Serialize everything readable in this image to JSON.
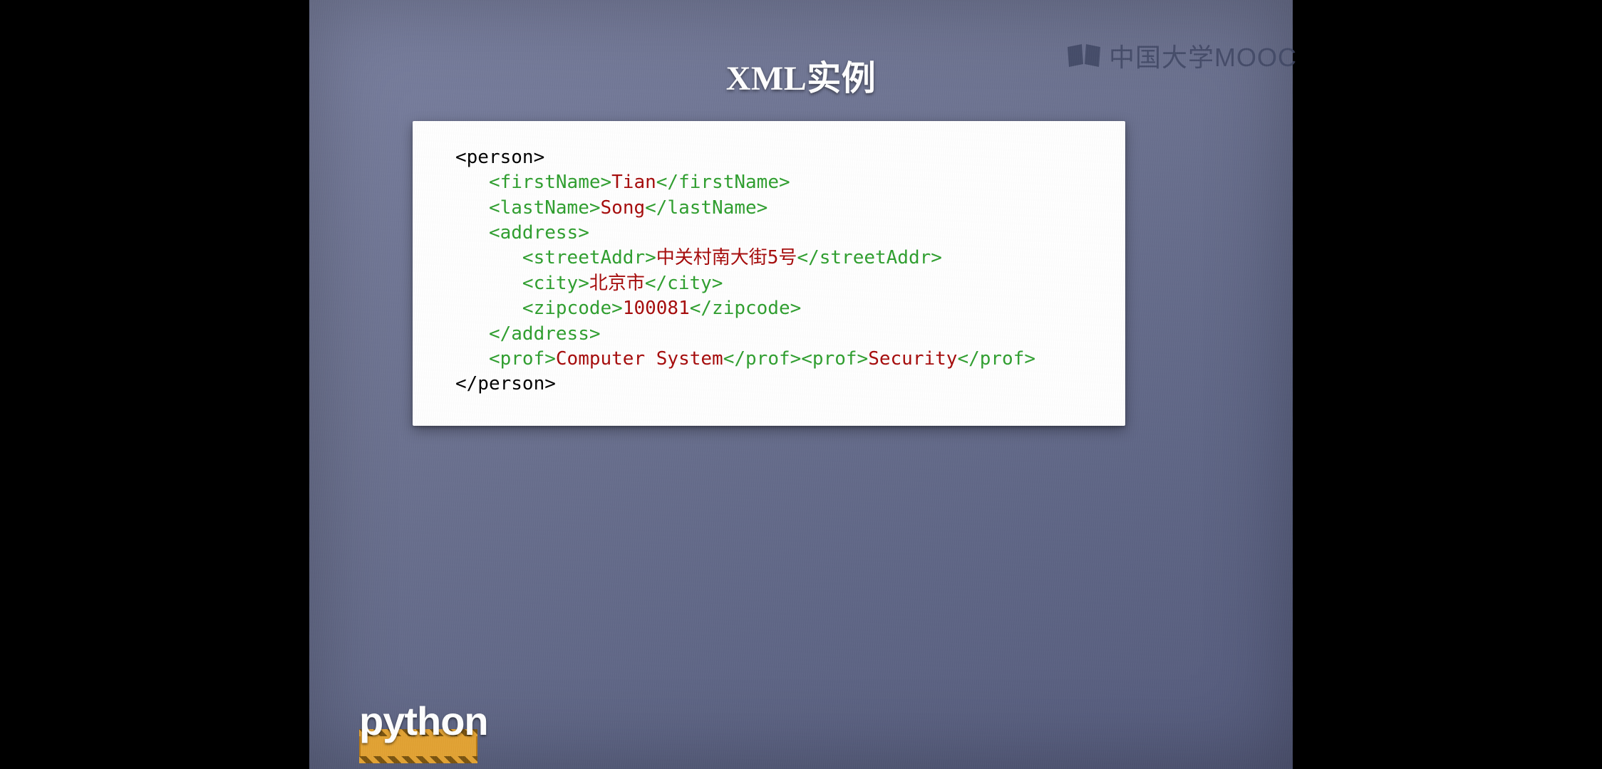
{
  "slide": {
    "title": "XML实例"
  },
  "watermark": {
    "text": "中国大学MOOC"
  },
  "badge": {
    "text": "python"
  },
  "code": {
    "lines": [
      {
        "indent": 0,
        "segments": [
          {
            "cls": "root",
            "t": "<person>"
          }
        ]
      },
      {
        "indent": 1,
        "segments": [
          {
            "cls": "tag",
            "t": "<firstName>"
          },
          {
            "cls": "text",
            "t": "Tian"
          },
          {
            "cls": "tag",
            "t": "</firstName>"
          }
        ]
      },
      {
        "indent": 1,
        "segments": [
          {
            "cls": "tag",
            "t": "<lastName>"
          },
          {
            "cls": "text",
            "t": "Song"
          },
          {
            "cls": "tag",
            "t": "</lastName>"
          }
        ]
      },
      {
        "indent": 1,
        "segments": [
          {
            "cls": "tag",
            "t": "<address>"
          }
        ]
      },
      {
        "indent": 2,
        "segments": [
          {
            "cls": "tag",
            "t": "<streetAddr>"
          },
          {
            "cls": "text",
            "t": "中关村南大街5号"
          },
          {
            "cls": "tag",
            "t": "</streetAddr>"
          }
        ]
      },
      {
        "indent": 2,
        "segments": [
          {
            "cls": "tag",
            "t": "<city>"
          },
          {
            "cls": "text",
            "t": "北京市"
          },
          {
            "cls": "tag",
            "t": "</city>"
          }
        ]
      },
      {
        "indent": 2,
        "segments": [
          {
            "cls": "tag",
            "t": "<zipcode>"
          },
          {
            "cls": "text",
            "t": "100081"
          },
          {
            "cls": "tag",
            "t": "</zipcode>"
          }
        ]
      },
      {
        "indent": 1,
        "segments": [
          {
            "cls": "tag",
            "t": "</address>"
          }
        ]
      },
      {
        "indent": 1,
        "segments": [
          {
            "cls": "tag",
            "t": "<prof>"
          },
          {
            "cls": "text",
            "t": "Computer System"
          },
          {
            "cls": "tag",
            "t": "</prof>"
          },
          {
            "cls": "tag",
            "t": "<prof>"
          },
          {
            "cls": "text",
            "t": "Security"
          },
          {
            "cls": "tag",
            "t": "</prof>"
          }
        ]
      },
      {
        "indent": 0,
        "segments": [
          {
            "cls": "root",
            "t": "</person>"
          }
        ]
      }
    ]
  }
}
